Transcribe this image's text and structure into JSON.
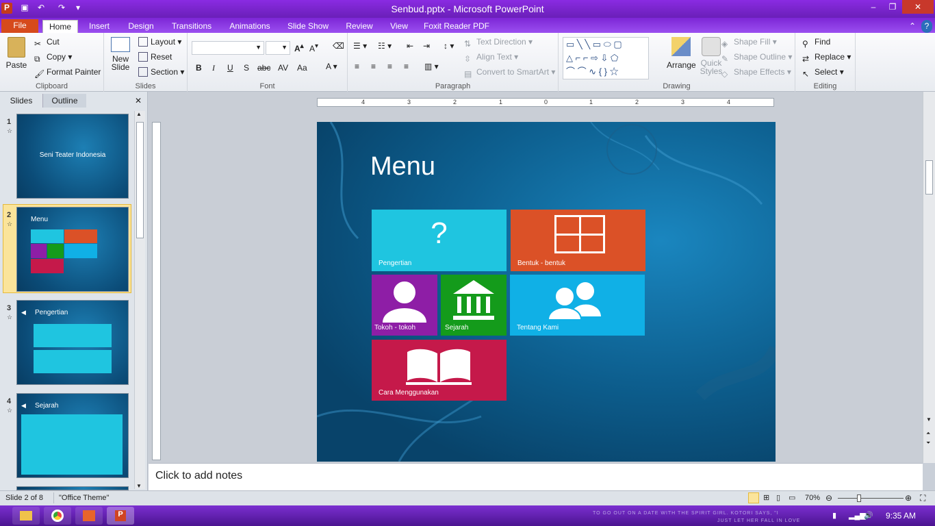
{
  "window": {
    "title": "Senbud.pptx - Microsoft PowerPoint"
  },
  "tabs": [
    "File",
    "Home",
    "Insert",
    "Design",
    "Transitions",
    "Animations",
    "Slide Show",
    "Review",
    "View",
    "Foxit Reader PDF"
  ],
  "clipboard": {
    "paste": "Paste",
    "cut": "Cut",
    "copy": "Copy",
    "format_painter": "Format Painter",
    "label": "Clipboard"
  },
  "slides_group": {
    "new_slide": "New Slide",
    "layout": "Layout",
    "reset": "Reset",
    "section": "Section",
    "label": "Slides"
  },
  "font_group": {
    "label": "Font"
  },
  "paragraph": {
    "text_direction": "Text Direction",
    "align_text": "Align Text",
    "smartart": "Convert to SmartArt",
    "label": "Paragraph"
  },
  "drawing": {
    "arrange": "Arrange",
    "quick_styles": "Quick Styles",
    "shape_fill": "Shape Fill",
    "shape_outline": "Shape Outline",
    "shape_effects": "Shape Effects",
    "label": "Drawing"
  },
  "editing": {
    "find": "Find",
    "replace": "Replace",
    "select": "Select",
    "label": "Editing"
  },
  "pane_tabs": {
    "slides": "Slides",
    "outline": "Outline"
  },
  "thumbs": [
    {
      "num": "1",
      "title": "Seni Teater Indonesia"
    },
    {
      "num": "2",
      "title": "Menu"
    },
    {
      "num": "3",
      "title": "Pengertian"
    },
    {
      "num": "4",
      "title": "Sejarah"
    }
  ],
  "slide": {
    "title": "Menu",
    "tiles": [
      {
        "label": "Pengertian",
        "color": "#1fc5e0"
      },
      {
        "label": "Bentuk - bentuk",
        "color": "#db5127"
      },
      {
        "label": "Tokoh - tokoh",
        "color": "#8e1ea6"
      },
      {
        "label": "Sejarah",
        "color": "#149b1b"
      },
      {
        "label": "Tentang Kami",
        "color": "#10b0e6"
      },
      {
        "label": "Cara Menggunakan",
        "color": "#c5194a"
      }
    ]
  },
  "ruler_h": [
    "4",
    "3",
    "2",
    "1",
    "0",
    "1",
    "2",
    "3",
    "4"
  ],
  "notes_placeholder": "Click to add notes",
  "status": {
    "slide": "Slide 2 of 8",
    "theme": "\"Office Theme\"",
    "zoom": "70%"
  },
  "taskbar": {
    "time": "9:35 AM",
    "ticker1": "TO GO OUT ON A DATE WITH THE SPIRIT GIRL. KOTORI SAYS, \"I",
    "ticker2": "JUST LET HER FALL IN LOVE"
  }
}
